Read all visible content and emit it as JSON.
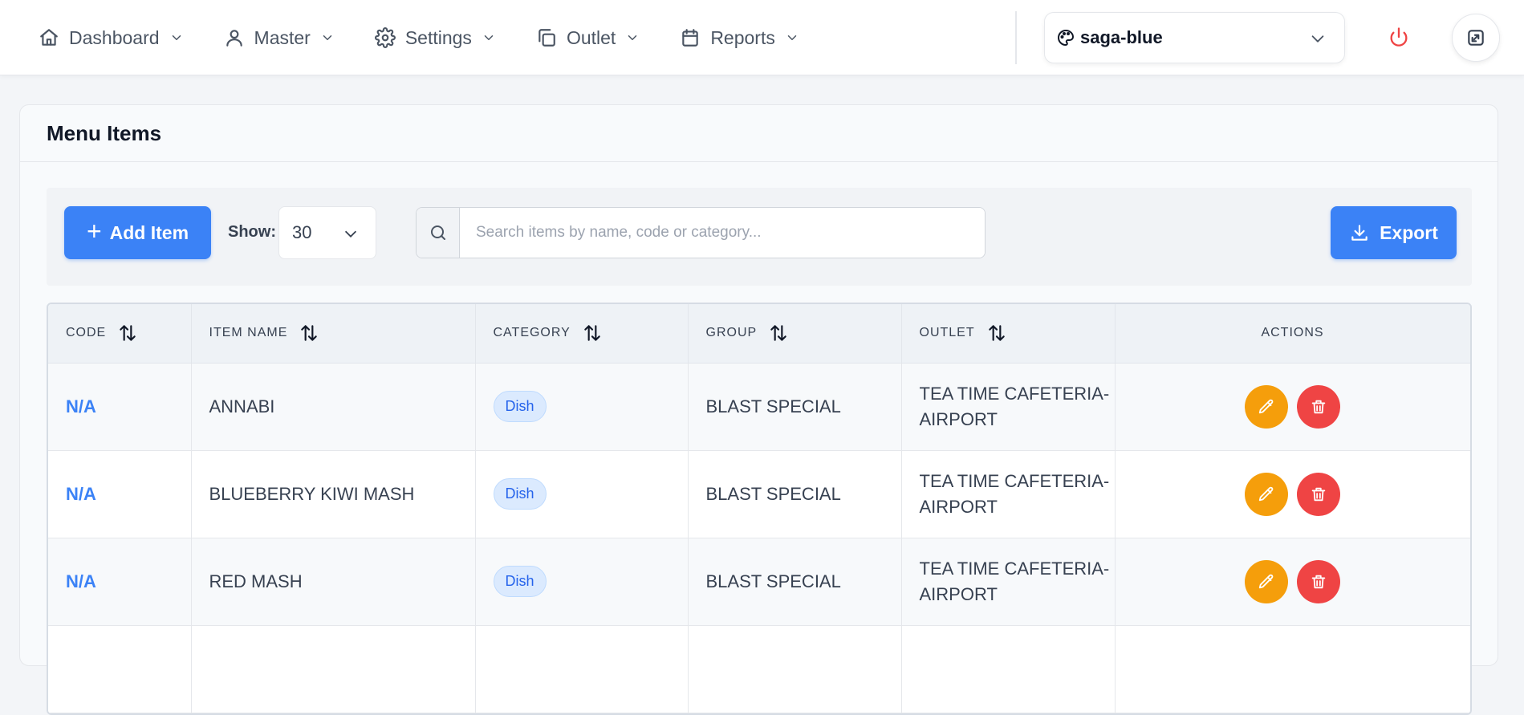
{
  "nav": {
    "items": [
      {
        "label": "Dashboard",
        "icon": "home-icon"
      },
      {
        "label": "Master",
        "icon": "user-icon"
      },
      {
        "label": "Settings",
        "icon": "gear-icon"
      },
      {
        "label": "Outlet",
        "icon": "copy-icon"
      },
      {
        "label": "Reports",
        "icon": "calendar-icon"
      }
    ],
    "theme": {
      "value": "saga-blue",
      "icon": "palette-icon"
    }
  },
  "page": {
    "title": "Menu Items"
  },
  "toolbar": {
    "add_label": "Add Item",
    "show_label": "Show:",
    "show_value": "30",
    "search_placeholder": "Search items by name, code or category...",
    "export_label": "Export"
  },
  "table": {
    "headers": {
      "code": "CODE",
      "item_name": "ITEM NAME",
      "category": "CATEGORY",
      "group": "GROUP",
      "outlet": "OUTLET",
      "actions": "ACTIONS"
    },
    "rows": [
      {
        "code": "N/A",
        "item_name": "ANNABI",
        "category": "Dish",
        "group": "BLAST SPECIAL",
        "outlet_line1": "TEA TIME CAFETERIA-",
        "outlet_line2": "AIRPORT"
      },
      {
        "code": "N/A",
        "item_name": "BLUEBERRY KIWI MASH",
        "category": "Dish",
        "group": "BLAST SPECIAL",
        "outlet_line1": "TEA TIME CAFETERIA-",
        "outlet_line2": "AIRPORT"
      },
      {
        "code": "N/A",
        "item_name": "RED MASH",
        "category": "Dish",
        "group": "BLAST SPECIAL",
        "outlet_line1": "TEA TIME CAFETERIA-",
        "outlet_line2": "AIRPORT"
      }
    ]
  },
  "colors": {
    "primary": "#3b82f6",
    "edit": "#f59e0b",
    "delete": "#ef4444",
    "power": "#ef4444"
  }
}
